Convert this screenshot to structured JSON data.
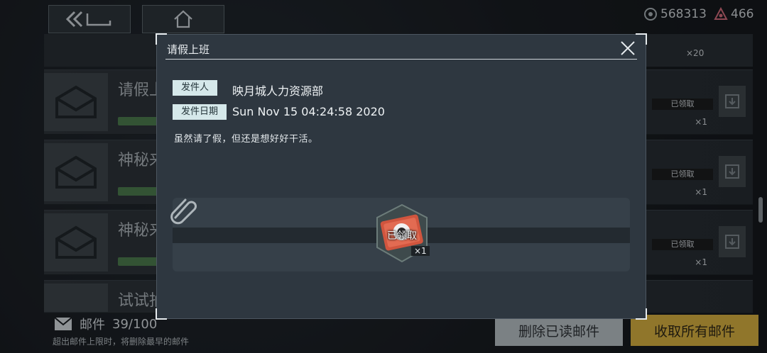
{
  "topbar": {
    "currency_a": "568313",
    "currency_b": "466"
  },
  "mail_list": {
    "rows": [
      {
        "title": "请假上班"
      },
      {
        "title": "神秘来"
      },
      {
        "title": "神秘来"
      },
      {
        "title": "试试抽"
      }
    ],
    "claimed_label": "已领取",
    "qty": "×1",
    "top_qty": "×20"
  },
  "footer": {
    "mail_label": "邮件",
    "mail_count": "39/100",
    "hint": "超出邮件上限时，将删除最早的邮件",
    "delete_read": "删除已读邮件",
    "claim_all": "收取所有邮件"
  },
  "modal": {
    "title": "请假上班",
    "sender_label": "发件人",
    "sender": "映月城人力资源部",
    "date_label": "发件日期",
    "date": "Sun Nov 15 04:24:58 2020",
    "body": "虽然请了假，但还是想好好干活。",
    "attachment": {
      "claimed_label": "已领取",
      "qty": "×1"
    }
  },
  "colors": {
    "accent_gold": "#d9b13d",
    "label_bg": "#d5e8ea",
    "modal_bg": "#2e3740"
  }
}
